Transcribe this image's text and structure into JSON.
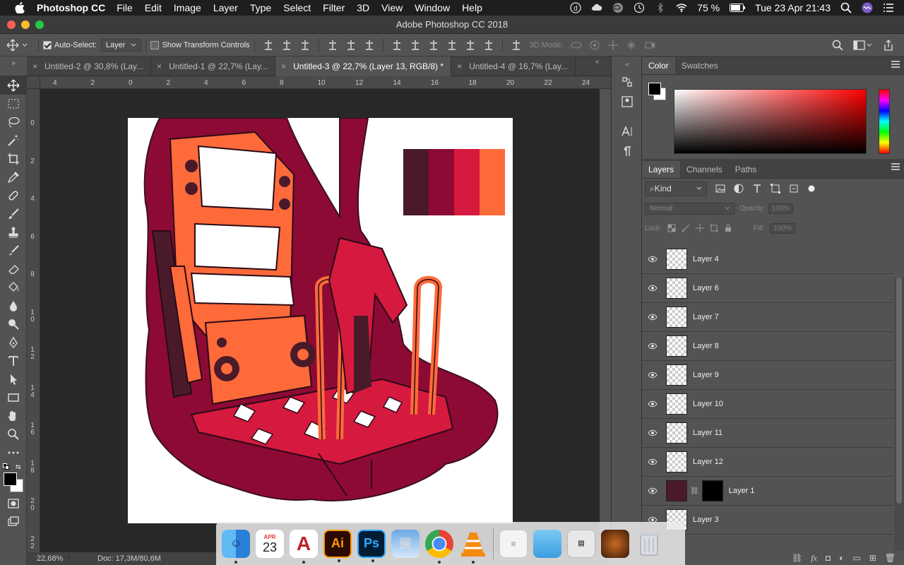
{
  "menubar": {
    "app_name": "Photoshop CC",
    "items": [
      "File",
      "Edit",
      "Image",
      "Layer",
      "Type",
      "Select",
      "Filter",
      "3D",
      "View",
      "Window",
      "Help"
    ],
    "battery": "75 %",
    "clock": "Tue 23 Apr  21:43"
  },
  "window": {
    "title": "Adobe Photoshop CC 2018"
  },
  "options": {
    "auto_select_label": "Auto-Select:",
    "auto_select_value": "Layer",
    "show_transform_label": "Show Transform Controls",
    "mode_3d_label": "3D Mode:"
  },
  "tabs": [
    {
      "label": "Untitled-2 @ 30,8% (Lay..."
    },
    {
      "label": "Untitled-1 @ 22,7% (Lay..."
    },
    {
      "label": "Untitled-3 @ 22,7% (Layer 13, RGB/8) *"
    },
    {
      "label": "Untitled-4 @ 16,7% (Lay..."
    }
  ],
  "ruler_h": [
    "4",
    "2",
    "0",
    "2",
    "4",
    "6",
    "8",
    "10",
    "12",
    "14",
    "16",
    "18",
    "20",
    "22",
    "24"
  ],
  "ruler_v": [
    "0",
    "2",
    "4",
    "6",
    "8",
    "1 0",
    "1 2",
    "1 4",
    "1 6",
    "1 8",
    "2 0",
    "2 2"
  ],
  "status": {
    "zoom": "22,68%",
    "doc": "Doc: 17,3M/80,6M"
  },
  "color_panel": {
    "tabs": [
      "Color",
      "Swatches"
    ],
    "fg": "#000000",
    "bg": "#ffffff"
  },
  "layers_panel": {
    "tabs": [
      "Layers",
      "Channels",
      "Paths"
    ],
    "filter_kind": "Kind",
    "blend_mode": "Normal",
    "opacity_label": "Opacity:",
    "opacity_value": "100%",
    "lock_label": "Lock:",
    "fill_label": "Fill:",
    "fill_value": "100%",
    "layers": [
      {
        "name": "Layer 4"
      },
      {
        "name": "Layer 6"
      },
      {
        "name": "Layer 7"
      },
      {
        "name": "Layer 8"
      },
      {
        "name": "Layer 9"
      },
      {
        "name": "Layer 10"
      },
      {
        "name": "Layer 11"
      },
      {
        "name": "Layer 12"
      },
      {
        "name": "Layer 1"
      },
      {
        "name": "Layer 3"
      }
    ]
  },
  "palette": [
    "#4a1a2a",
    "#8c0a34",
    "#d6193f",
    "#ff6a3a"
  ],
  "dock": {
    "calendar_month": "APR",
    "calendar_day": "23",
    "apps": [
      "finder-icon",
      "calendar-icon",
      "autocad-icon",
      "illustrator-icon",
      "photoshop-icon",
      "preview-icon",
      "chrome-icon",
      "vlc-icon",
      "document-icon",
      "folder-icon",
      "screenshot-icon",
      "photo-icon",
      "trash-icon"
    ],
    "ai_label": "Ai",
    "ps_label": "Ps"
  }
}
